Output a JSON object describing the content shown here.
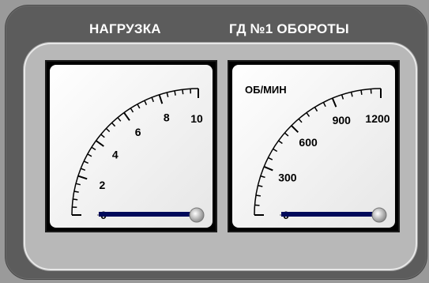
{
  "headers": {
    "load": "НАГРУЗКА",
    "rpm": "ГД №1 ОБОРОТЫ"
  },
  "gauge_load": {
    "ticks": [
      "0",
      "2",
      "4",
      "6",
      "8",
      "10"
    ],
    "value_fraction": 0.0
  },
  "gauge_rpm": {
    "unit": "ОБ/МИН",
    "ticks": [
      "0",
      "300",
      "600",
      "900",
      "1200"
    ],
    "value_fraction": 0.0
  },
  "colors": {
    "panel": "#5c5c5c",
    "frame": "#b8b8b8",
    "dial_face": "#ffffff",
    "needle": "#000a5a"
  }
}
